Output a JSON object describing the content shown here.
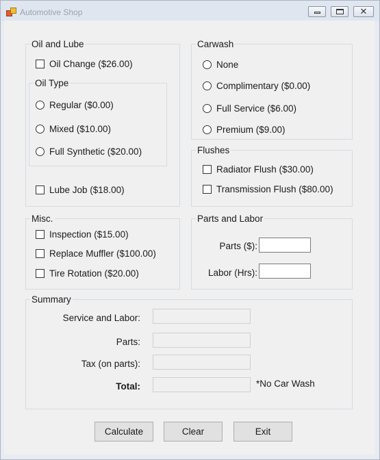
{
  "window": {
    "title": "Automotive Shop",
    "controls": {
      "minimize": "minimize",
      "maximize": "maximize",
      "close": "✕"
    }
  },
  "oil_and_lube": {
    "title": "Oil and Lube",
    "oil_change": "Oil Change ($26.00)",
    "oil_type": {
      "title": "Oil Type",
      "options": [
        "Regular ($0.00)",
        "Mixed ($10.00)",
        "Full Synthetic ($20.00)"
      ]
    },
    "lube_job": "Lube Job ($18.00)"
  },
  "carwash": {
    "title": "Carwash",
    "options": [
      "None",
      "Complimentary ($0.00)",
      "Full Service ($6.00)",
      "Premium ($9.00)"
    ]
  },
  "flushes": {
    "title": "Flushes",
    "items": [
      "Radiator Flush ($30.00)",
      "Transmission Flush ($80.00)"
    ]
  },
  "misc": {
    "title": "Misc.",
    "items": [
      "Inspection ($15.00)",
      "Replace Muffler ($100.00)",
      "Tire Rotation ($20.00)"
    ]
  },
  "parts_and_labor": {
    "title": "Parts and Labor",
    "parts_label": "Parts ($):",
    "parts_value": "",
    "labor_label": "Labor (Hrs):",
    "labor_value": ""
  },
  "summary": {
    "title": "Summary",
    "service_labor_label": "Service and Labor:",
    "service_labor_value": "",
    "parts_label": "Parts:",
    "parts_value": "",
    "tax_label": "Tax (on parts):",
    "tax_value": "",
    "total_label": "Total:",
    "total_value": "",
    "note": "*No Car Wash"
  },
  "buttons": {
    "calculate": "Calculate",
    "clear": "Clear",
    "exit": "Exit"
  }
}
